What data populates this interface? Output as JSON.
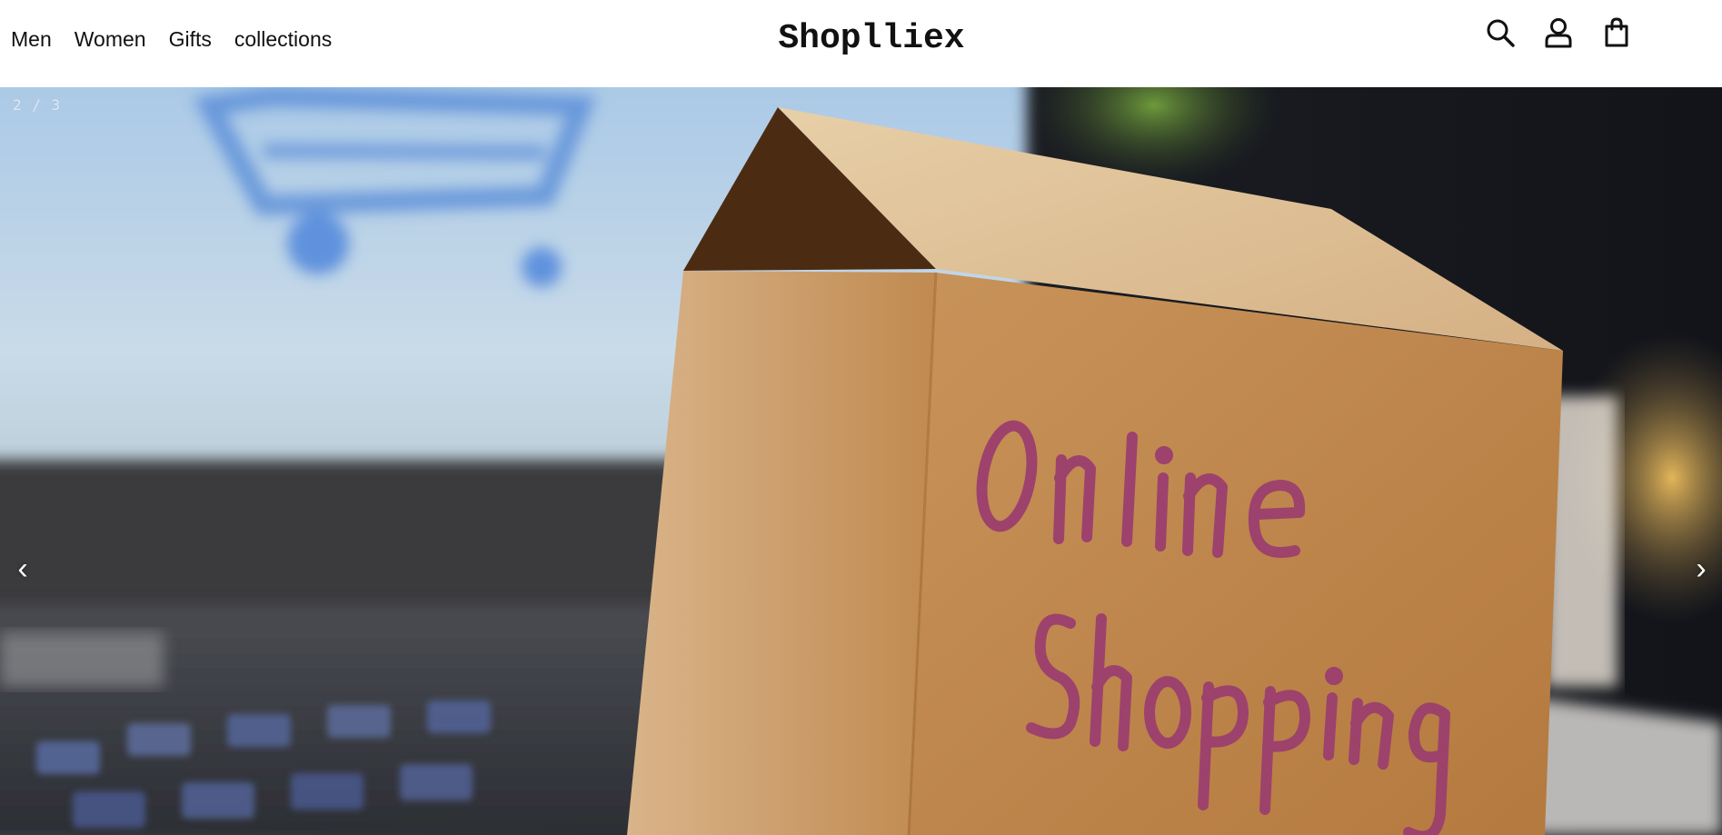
{
  "header": {
    "nav": [
      {
        "label": "Men"
      },
      {
        "label": "Women"
      },
      {
        "label": "Gifts"
      },
      {
        "label": "collections"
      }
    ],
    "brand": "Shoplliex",
    "icons": [
      "search-icon",
      "user-icon",
      "shopping-bag-icon"
    ]
  },
  "hero": {
    "counter": "2 / 3",
    "prev_arrow": "‹",
    "next_arrow": "›",
    "image_text": [
      "Online",
      "Shopping"
    ],
    "image_alt": "Cardboard box labeled Online Shopping in front of a laptop"
  },
  "colors": {
    "header_bg": "#ffffff",
    "text": "#111111",
    "box_brown": "#c08a4f",
    "box_lettering": "#9c3f6e"
  }
}
